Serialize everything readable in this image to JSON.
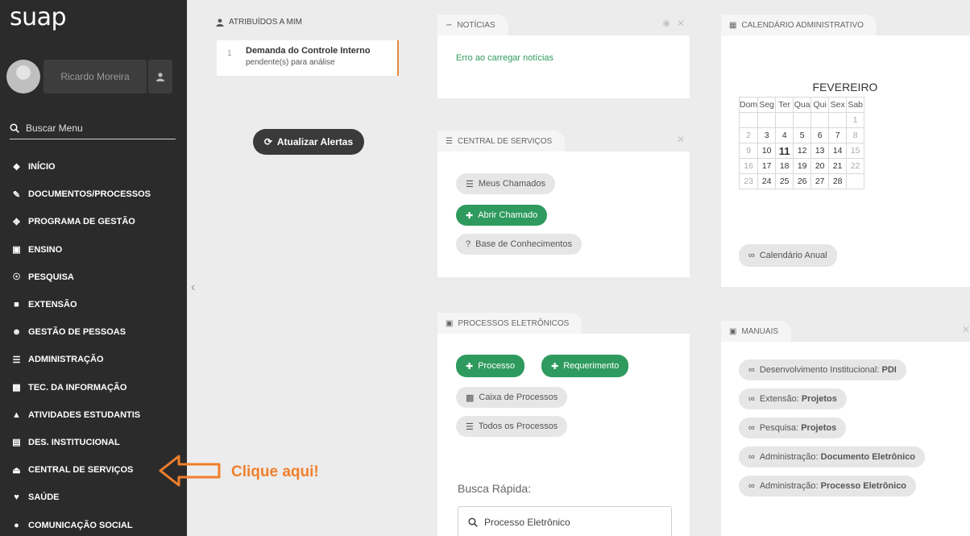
{
  "app": {
    "logo": "suap"
  },
  "user": {
    "name": "Ricardo Moreira"
  },
  "search": {
    "placeholder": "Buscar Menu"
  },
  "menu": [
    {
      "label": "INÍCIO",
      "icon": "home-icon"
    },
    {
      "label": "DOCUMENTOS/PROCESSOS",
      "icon": "document-icon"
    },
    {
      "label": "PROGRAMA DE GESTÃO",
      "icon": "management-icon"
    },
    {
      "label": "ENSINO",
      "icon": "teaching-icon"
    },
    {
      "label": "PESQUISA",
      "icon": "globe-icon"
    },
    {
      "label": "EXTENSÃO",
      "icon": "building-icon"
    },
    {
      "label": "GESTÃO DE PESSOAS",
      "icon": "people-icon"
    },
    {
      "label": "ADMINISTRAÇÃO",
      "icon": "list-icon"
    },
    {
      "label": "TEC. DA INFORMAÇÃO",
      "icon": "monitor-icon"
    },
    {
      "label": "ATIVIDADES ESTUDANTIS",
      "icon": "graduation-icon"
    },
    {
      "label": "DES. INSTITUCIONAL",
      "icon": "chart-icon"
    },
    {
      "label": "CENTRAL DE SERVIÇOS",
      "icon": "eject-icon"
    },
    {
      "label": "SAÚDE",
      "icon": "heart-icon"
    },
    {
      "label": "COMUNICAÇÃO SOCIAL",
      "icon": "comment-icon"
    }
  ],
  "alerts": {
    "header": "ATRIBUÍDOS A MIM",
    "item": {
      "number": "1",
      "title": "Demanda do Controle Interno",
      "subtitle": "pendente(s) para análise"
    },
    "refresh_label": "Atualizar Alertas"
  },
  "news": {
    "title": "NOTÍCIAS",
    "error": "Erro ao carregar notícias"
  },
  "services": {
    "title": "CENTRAL DE SERVIÇOS",
    "my_tickets": "Meus Chamados",
    "open_ticket": "Abrir Chamado",
    "knowledge_base": "Base de Conhecimentos"
  },
  "processes": {
    "title": "PROCESSOS ELETRÔNICOS",
    "new_process": "Processo",
    "new_request": "Requerimento",
    "inbox": "Caixa de Processos",
    "all": "Todos os Processos",
    "quick_search_label": "Busca Rápida:",
    "quick_search_value": "Processo Eletrônico"
  },
  "calendar": {
    "title": "CALENDÁRIO ADMINISTRATIVO",
    "month": "FEVEREIRO",
    "weekdays": [
      "Dom",
      "Seg",
      "Ter",
      "Qua",
      "Qui",
      "Sex",
      "Sab"
    ],
    "weeks": [
      [
        "",
        "",
        "",
        "",
        "",
        "",
        "1"
      ],
      [
        "2",
        "3",
        "4",
        "5",
        "6",
        "7",
        "8"
      ],
      [
        "9",
        "10",
        "11",
        "12",
        "13",
        "14",
        "15"
      ],
      [
        "16",
        "17",
        "18",
        "19",
        "20",
        "21",
        "22"
      ],
      [
        "23",
        "24",
        "25",
        "26",
        "27",
        "28",
        ""
      ]
    ],
    "outside_days": [
      "1",
      "2",
      "8",
      "9",
      "15",
      "16",
      "22",
      "23"
    ],
    "today": "11",
    "annual_link": "Calendário Anual"
  },
  "manuals": {
    "title": "MANUAIS",
    "links": [
      {
        "prefix": "Desenvolvimento Institucional: ",
        "bold": "PDI"
      },
      {
        "prefix": "Extensão: ",
        "bold": "Projetos"
      },
      {
        "prefix": "Pesquisa: ",
        "bold": "Projetos"
      },
      {
        "prefix": "Administração: ",
        "bold": "Documento Eletrônico"
      },
      {
        "prefix": "Administração: ",
        "bold": "Processo Eletrônico"
      }
    ]
  },
  "annotation": {
    "text": "Clique aqui!"
  },
  "colors": {
    "sidebar": "#2b2b2b",
    "accent_green": "#2e9a5e",
    "annotation_orange": "#f07f2a"
  }
}
